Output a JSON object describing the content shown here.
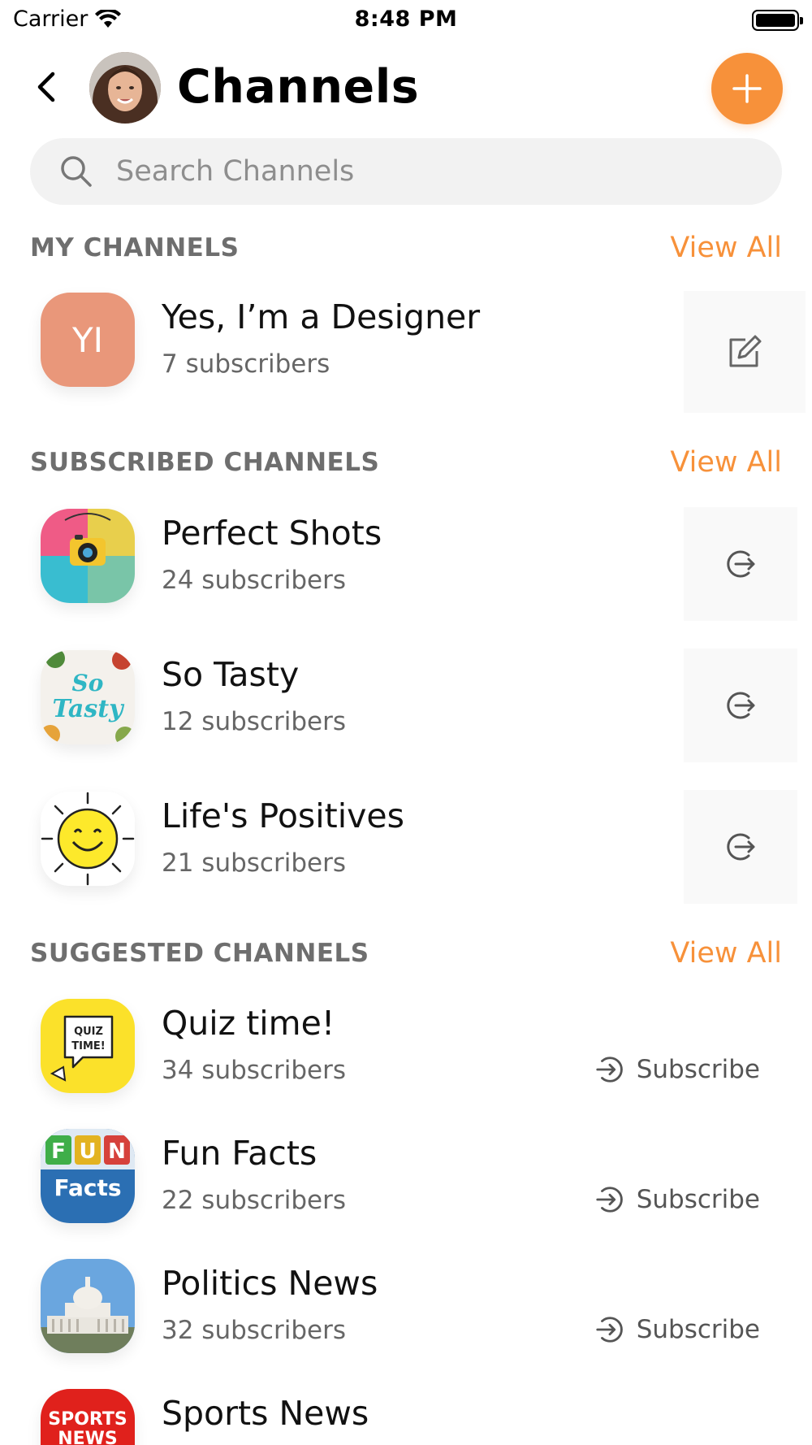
{
  "status_bar": {
    "carrier": "Carrier",
    "time": "8:48 PM"
  },
  "header": {
    "title": "Channels"
  },
  "search": {
    "placeholder": "Search Channels"
  },
  "sections": {
    "my": {
      "title": "MY CHANNELS",
      "view_all": "View All"
    },
    "subscribed": {
      "title": "SUBSCRIBED CHANNELS",
      "view_all": "View All"
    },
    "suggested": {
      "title": "SUGGESTED CHANNELS",
      "view_all": "View All"
    }
  },
  "my_channels": [
    {
      "initials": "YI",
      "name": "Yes, I’m a Designer",
      "subscribers": "7 subscribers",
      "action_icon": "edit-icon"
    }
  ],
  "subscribed_channels": [
    {
      "name": "Perfect Shots",
      "subscribers": "24 subscribers",
      "action_icon": "leave-icon"
    },
    {
      "name": "So Tasty",
      "subscribers": "12 subscribers",
      "action_icon": "leave-icon",
      "logo_text": "So Tasty"
    },
    {
      "name": "Life's Positives",
      "subscribers": "21 subscribers",
      "action_icon": "leave-icon"
    }
  ],
  "suggested_channels": [
    {
      "name": "Quiz time!",
      "subscribers": "34 subscribers",
      "action_label": "Subscribe",
      "logo_text": "QUIZ TIME!"
    },
    {
      "name": "Fun Facts",
      "subscribers": "22 subscribers",
      "action_label": "Subscribe",
      "logo_text": "FUN Facts"
    },
    {
      "name": "Politics News",
      "subscribers": "32 subscribers",
      "action_label": "Subscribe"
    },
    {
      "name": "Sports News",
      "subscribers": "",
      "logo_text": "SPORTS NEWS"
    }
  ],
  "colors": {
    "accent": "#f7913a",
    "section_title": "#6e6e6e",
    "search_bg": "#f2f2f2"
  }
}
